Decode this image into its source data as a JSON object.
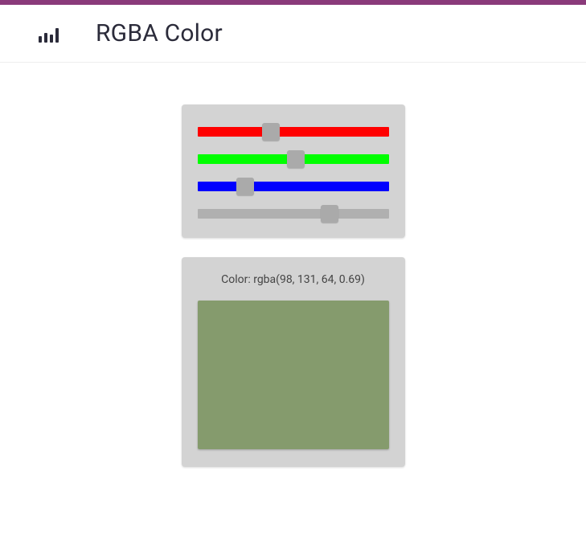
{
  "brand_bar_color": "#8a3a7a",
  "header": {
    "title": "RGBA Color",
    "logo_bars": [
      8,
      12,
      10,
      18
    ]
  },
  "sliders": {
    "red": {
      "track_color": "#ff0000",
      "value": 98,
      "max": 255
    },
    "green": {
      "track_color": "#00ff00",
      "value": 131,
      "max": 255
    },
    "blue": {
      "track_color": "#0000ff",
      "value": 64,
      "max": 255
    },
    "alpha": {
      "track_color": "#b0b0b0",
      "value": 0.69,
      "max": 1
    }
  },
  "result": {
    "label": "Color: rgba(98, 131, 64, 0.69)",
    "rgba": [
      98,
      131,
      64,
      0.69
    ]
  }
}
